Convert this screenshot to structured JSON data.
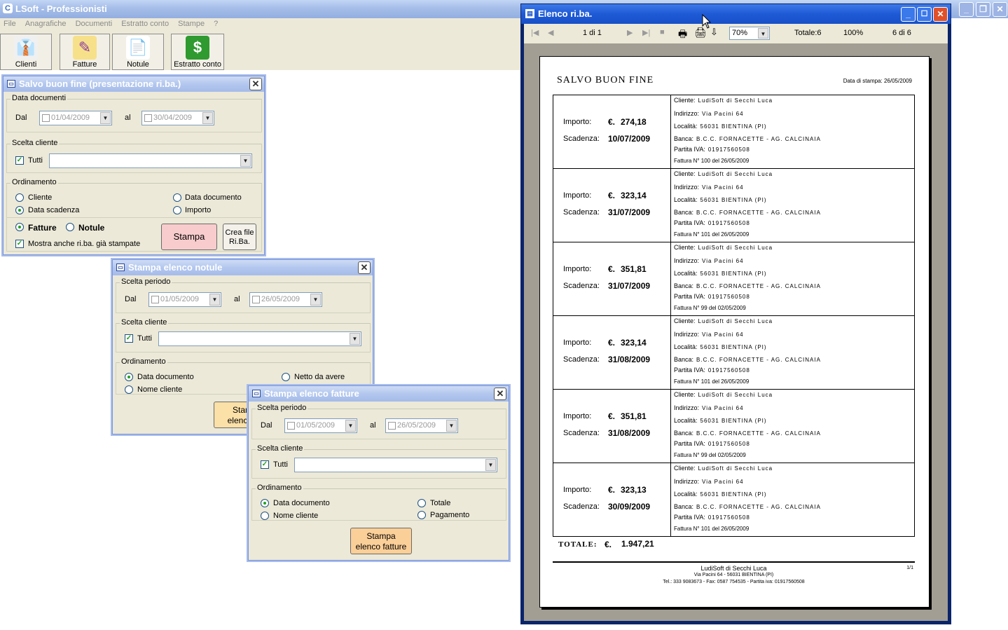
{
  "app": {
    "title": "LSoft - Professionisti"
  },
  "menu": [
    "File",
    "Anagrafiche",
    "Documenti",
    "Estratto conto",
    "Stampe",
    "?"
  ],
  "toolbar": [
    {
      "label": "Clienti",
      "icon": "clients-icon",
      "glyph": "👔"
    },
    {
      "label": "Fatture",
      "icon": "invoices-icon",
      "glyph": "✎"
    },
    {
      "label": "Notule",
      "icon": "notes-icon",
      "glyph": "📄"
    },
    {
      "label": "Estratto conto",
      "icon": "statement-icon",
      "glyph": "$"
    }
  ],
  "sbf": {
    "title": "Salvo buon fine (presentazione ri.ba.)",
    "group_dates": "Data documenti",
    "dal": "Dal",
    "from": "01/04/2009",
    "al": "al",
    "to": "30/04/2009",
    "group_client": "Scelta cliente",
    "tutti": "Tutti",
    "group_order": "Ordinamento",
    "opt_cliente": "Cliente",
    "opt_data_doc": "Data documento",
    "opt_scadenza": "Data scadenza",
    "opt_importo": "Importo",
    "fatture": "Fatture",
    "notule": "Notule",
    "mostra": "Mostra anche ri.ba. già stampate",
    "stampa": "Stampa",
    "crea1": "Crea file",
    "crea2": "Ri.Ba."
  },
  "sen": {
    "title": "Stampa elenco notule",
    "group_period": "Scelta periodo",
    "dal": "Dal",
    "from": "01/05/2009",
    "al": "al",
    "to": "26/05/2009",
    "group_client": "Scelta cliente",
    "tutti": "Tutti",
    "group_order": "Ordinamento",
    "opt_data_doc": "Data documento",
    "opt_netto": "Netto da avere",
    "opt_nome": "Nome cliente",
    "btn1": "Stam",
    "btn2": "elenco"
  },
  "sef": {
    "title": "Stampa elenco fatture",
    "group_period": "Scelta periodo",
    "dal": "Dal",
    "from": "01/05/2009",
    "al": "al",
    "to": "26/05/2009",
    "group_client": "Scelta cliente",
    "tutti": "Tutti",
    "group_order": "Ordinamento",
    "opt_data_doc": "Data documento",
    "opt_totale": "Totale",
    "opt_nome": "Nome cliente",
    "opt_pagamento": "Pagamento",
    "btn1": "Stampa",
    "btn2": "elenco fatture"
  },
  "report": {
    "title": "Elenco ri.ba.",
    "page": "1 di 1",
    "zoom": "70%",
    "totale_label": "Totale:6",
    "percent": "100%",
    "count": "6 di 6",
    "doc_title": "SALVO BUON FINE",
    "print_date": "Data di stampa: 26/05/2009",
    "k_importo": "Importo:",
    "k_scadenza": "Scadenza:",
    "currency": "€.",
    "k_cliente": "Cliente:",
    "k_indirizzo": "Indirizzo:",
    "k_localita": "Località:",
    "k_banca": "Banca:",
    "k_piva": "Partita IVA:",
    "rows": [
      {
        "importo": "274,18",
        "scadenza": "10/07/2009",
        "cliente": "LudiSoft di Secchi Luca",
        "indirizzo": "Via Pacini 64",
        "localita": "56031 BIENTINA (PI)",
        "banca": "B.C.C. FORNACETTE - AG. CALCINAIA",
        "piva": "01917560508",
        "fattura": "Fattura N° 100  del 26/05/2009"
      },
      {
        "importo": "323,14",
        "scadenza": "31/07/2009",
        "cliente": "LudiSoft di Secchi Luca",
        "indirizzo": "Via Pacini 64",
        "localita": "56031 BIENTINA (PI)",
        "banca": "B.C.C. FORNACETTE - AG. CALCINAIA",
        "piva": "01917560508",
        "fattura": "Fattura N° 101  del 26/05/2009"
      },
      {
        "importo": "351,81",
        "scadenza": "31/07/2009",
        "cliente": "LudiSoft di Secchi Luca",
        "indirizzo": "Via Pacini 64",
        "localita": "56031 BIENTINA (PI)",
        "banca": "B.C.C. FORNACETTE - AG. CALCINAIA",
        "piva": "01917560508",
        "fattura": "Fattura N° 99  del 02/05/2009"
      },
      {
        "importo": "323,14",
        "scadenza": "31/08/2009",
        "cliente": "LudiSoft di Secchi Luca",
        "indirizzo": "Via Pacini 64",
        "localita": "56031 BIENTINA (PI)",
        "banca": "B.C.C. FORNACETTE - AG. CALCINAIA",
        "piva": "01917560508",
        "fattura": "Fattura N° 101  del 26/05/2009"
      },
      {
        "importo": "351,81",
        "scadenza": "31/08/2009",
        "cliente": "LudiSoft di Secchi Luca",
        "indirizzo": "Via Pacini 64",
        "localita": "56031 BIENTINA (PI)",
        "banca": "B.C.C. FORNACETTE - AG. CALCINAIA",
        "piva": "01917560508",
        "fattura": "Fattura N° 99  del 02/05/2009"
      },
      {
        "importo": "323,13",
        "scadenza": "30/09/2009",
        "cliente": "LudiSoft di Secchi Luca",
        "indirizzo": "Via Pacini 64",
        "localita": "56031 BIENTINA (PI)",
        "banca": "B.C.C. FORNACETTE - AG. CALCINAIA",
        "piva": "01917560508",
        "fattura": "Fattura N° 101  del 26/05/2009"
      }
    ],
    "totale": "TOTALE:",
    "totale_val": "1.947,21",
    "footer1": "LudiSoft di Secchi Luca",
    "footer2": "Via Pacini 64 - 56031 BIENTINA (PI)",
    "footer3": "Tel.: 333 9083673 - Fax: 0587 754535 - Partita iva: 01917560508",
    "page_num": "1/1"
  }
}
